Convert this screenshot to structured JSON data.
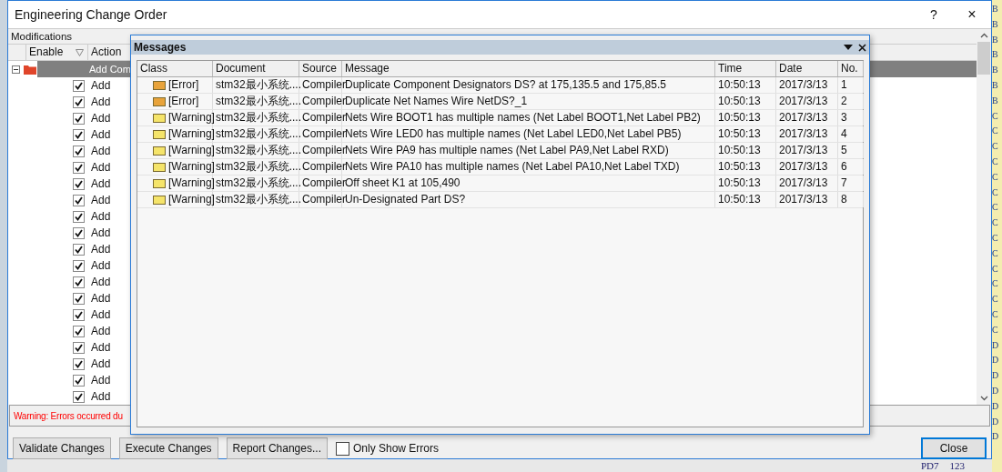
{
  "window": {
    "title": "Engineering Change Order",
    "help": "?",
    "close": "×"
  },
  "modifications": {
    "title": "Modifications",
    "columns": [
      "Enable",
      "Action"
    ],
    "rows": [
      {
        "kind": "group",
        "action": "Add Com",
        "expanded": true,
        "selected": true
      },
      {
        "kind": "item",
        "action": "Add",
        "checked": true
      },
      {
        "kind": "item",
        "action": "Add",
        "checked": true
      },
      {
        "kind": "item",
        "action": "Add",
        "checked": true
      },
      {
        "kind": "item",
        "action": "Add",
        "checked": true
      },
      {
        "kind": "item",
        "action": "Add",
        "checked": true
      },
      {
        "kind": "item",
        "action": "Add",
        "checked": true
      },
      {
        "kind": "item",
        "action": "Add",
        "checked": true
      },
      {
        "kind": "item",
        "action": "Add",
        "checked": true
      },
      {
        "kind": "item",
        "action": "Add",
        "checked": true
      },
      {
        "kind": "item",
        "action": "Add",
        "checked": true
      },
      {
        "kind": "item",
        "action": "Add",
        "checked": true
      },
      {
        "kind": "item",
        "action": "Add",
        "checked": true
      },
      {
        "kind": "item",
        "action": "Add",
        "checked": true
      },
      {
        "kind": "item",
        "action": "Add",
        "checked": true
      },
      {
        "kind": "item",
        "action": "Add",
        "checked": true
      },
      {
        "kind": "item",
        "action": "Add",
        "checked": true
      },
      {
        "kind": "item",
        "action": "Add",
        "checked": true
      },
      {
        "kind": "item",
        "action": "Add",
        "checked": true
      },
      {
        "kind": "item",
        "action": "Add",
        "checked": true
      },
      {
        "kind": "item",
        "action": "Add",
        "checked": true
      }
    ]
  },
  "status": "Warning: Errors occurred du",
  "buttons": [
    {
      "label": "Validate Changes"
    },
    {
      "label": "Execute Changes"
    },
    {
      "label": "Report Changes..."
    }
  ],
  "only_show_errors": {
    "label": "Only Show Errors",
    "checked": false
  },
  "close_button": "Close",
  "messages": {
    "title": "Messages",
    "columns": [
      "Class",
      "Document",
      "Source",
      "Message",
      "Time",
      "Date",
      "No."
    ],
    "rows": [
      {
        "kind": "error",
        "class": "[Error]",
        "document": "stm32最小系统....",
        "source": "Compiler",
        "message": "Duplicate Component Designators DS? at 175,135.5 and 175,85.5",
        "time": "10:50:13",
        "date": "2017/3/13",
        "no": "1"
      },
      {
        "kind": "error",
        "class": "[Error]",
        "document": "stm32最小系统....",
        "source": "Compiler",
        "message": "Duplicate Net Names Wire NetDS?_1",
        "time": "10:50:13",
        "date": "2017/3/13",
        "no": "2"
      },
      {
        "kind": "warning",
        "class": "[Warning]",
        "document": "stm32最小系统....",
        "source": "Compiler",
        "message": "Nets Wire BOOT1 has multiple names (Net Label BOOT1,Net Label PB2)",
        "time": "10:50:13",
        "date": "2017/3/13",
        "no": "3"
      },
      {
        "kind": "warning",
        "class": "[Warning]",
        "document": "stm32最小系统....",
        "source": "Compiler",
        "message": "Nets Wire LED0 has multiple names (Net Label LED0,Net Label PB5)",
        "time": "10:50:13",
        "date": "2017/3/13",
        "no": "4"
      },
      {
        "kind": "warning",
        "class": "[Warning]",
        "document": "stm32最小系统....",
        "source": "Compiler",
        "message": "Nets Wire PA9 has multiple names (Net Label PA9,Net Label RXD)",
        "time": "10:50:13",
        "date": "2017/3/13",
        "no": "5"
      },
      {
        "kind": "warning",
        "class": "[Warning]",
        "document": "stm32最小系统....",
        "source": "Compiler",
        "message": "Nets Wire PA10 has multiple names (Net Label PA10,Net Label TXD)",
        "time": "10:50:13",
        "date": "2017/3/13",
        "no": "6"
      },
      {
        "kind": "warning",
        "class": "[Warning]",
        "document": "stm32最小系统....",
        "source": "Compiler",
        "message": "Off sheet K1 at 105,490",
        "time": "10:50:13",
        "date": "2017/3/13",
        "no": "7"
      },
      {
        "kind": "warning",
        "class": "[Warning]",
        "document": "stm32最小系统....",
        "source": "Compiler",
        "message": "Un-Designated Part DS?",
        "time": "10:50:13",
        "date": "2017/3/13",
        "no": "8"
      }
    ]
  },
  "background": {
    "edge_letters": [
      "B",
      "B",
      "B",
      "B",
      "B",
      "B",
      "B",
      "C",
      "C",
      "C",
      "C",
      "C",
      "C",
      "C",
      "C",
      "C",
      "C",
      "C",
      "C",
      "C",
      "C",
      "C",
      "D",
      "D",
      "D",
      "D",
      "D",
      "D",
      "D"
    ],
    "bottom_labels": [
      "PD7",
      "123"
    ]
  }
}
